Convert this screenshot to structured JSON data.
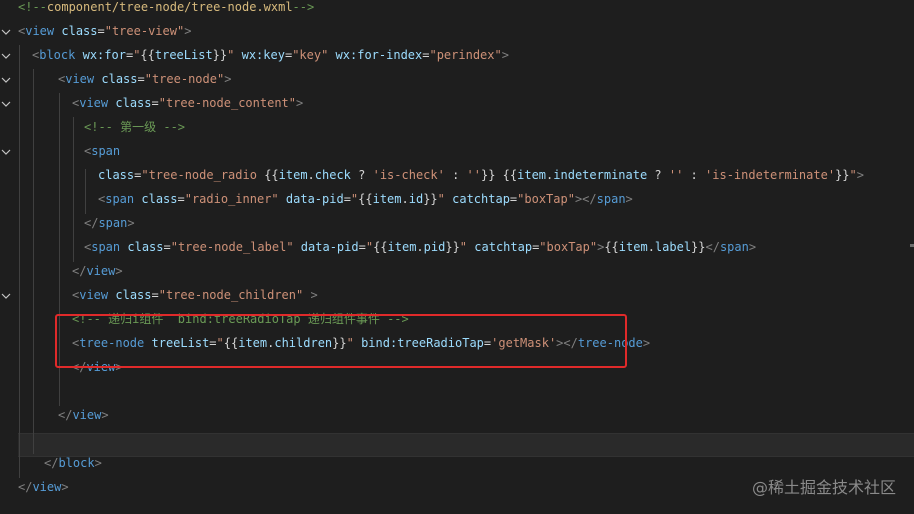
{
  "editor": {
    "colors": {
      "background": "#1e1e1e",
      "current_line": "#2a2a2a",
      "highlight_box": "#e02a2a",
      "comment": "#6a9955",
      "tag": "#569cd6",
      "attribute": "#9cdcfe",
      "string": "#ce9178",
      "text": "#d4d4d4"
    },
    "fold_icon": "chevron-down-icon",
    "lines": [
      {
        "tokens": [
          {
            "t": "<!--",
            "c": "c-comment"
          },
          {
            "t": "component/tree-node/tree-node.wxml",
            "c": "c-path"
          },
          {
            "t": "-->",
            "c": "c-comment"
          }
        ]
      },
      {
        "tokens": [
          {
            "t": "<",
            "c": "c-bracket"
          },
          {
            "t": "view",
            "c": "c-tag"
          },
          {
            "t": " ",
            "c": "c-text"
          },
          {
            "t": "class",
            "c": "c-attr"
          },
          {
            "t": "=",
            "c": "c-text"
          },
          {
            "t": "\"tree-view\"",
            "c": "c-str"
          },
          {
            "t": ">",
            "c": "c-bracket"
          }
        ]
      },
      {
        "tokens": [
          {
            "t": "<",
            "c": "c-bracket"
          },
          {
            "t": "block",
            "c": "c-tag"
          },
          {
            "t": " ",
            "c": "c-text"
          },
          {
            "t": "wx:for",
            "c": "c-attr"
          },
          {
            "t": "=",
            "c": "c-text"
          },
          {
            "t": "\"",
            "c": "c-str"
          },
          {
            "t": "{{",
            "c": "c-text"
          },
          {
            "t": "treeList",
            "c": "c-attr"
          },
          {
            "t": "}}",
            "c": "c-text"
          },
          {
            "t": "\"",
            "c": "c-str"
          },
          {
            "t": " ",
            "c": "c-text"
          },
          {
            "t": "wx:key",
            "c": "c-attr"
          },
          {
            "t": "=",
            "c": "c-text"
          },
          {
            "t": "\"key\"",
            "c": "c-str"
          },
          {
            "t": " ",
            "c": "c-text"
          },
          {
            "t": "wx:for-index",
            "c": "c-attr"
          },
          {
            "t": "=",
            "c": "c-text"
          },
          {
            "t": "\"perindex\"",
            "c": "c-str"
          },
          {
            "t": ">",
            "c": "c-bracket"
          }
        ]
      },
      {
        "tokens": [
          {
            "t": "<",
            "c": "c-bracket"
          },
          {
            "t": "view",
            "c": "c-tag"
          },
          {
            "t": " ",
            "c": "c-text"
          },
          {
            "t": "class",
            "c": "c-attr"
          },
          {
            "t": "=",
            "c": "c-text"
          },
          {
            "t": "\"tree-node\"",
            "c": "c-str"
          },
          {
            "t": ">",
            "c": "c-bracket"
          }
        ]
      },
      {
        "tokens": [
          {
            "t": "<",
            "c": "c-bracket"
          },
          {
            "t": "view",
            "c": "c-tag"
          },
          {
            "t": " ",
            "c": "c-text"
          },
          {
            "t": "class",
            "c": "c-attr"
          },
          {
            "t": "=",
            "c": "c-text"
          },
          {
            "t": "\"tree-node_content\"",
            "c": "c-str"
          },
          {
            "t": ">",
            "c": "c-bracket"
          }
        ]
      },
      {
        "tokens": [
          {
            "t": "<!-- 第一级 -->",
            "c": "c-comment"
          }
        ]
      },
      {
        "tokens": [
          {
            "t": "<",
            "c": "c-bracket"
          },
          {
            "t": "span",
            "c": "c-tag"
          }
        ]
      },
      {
        "tokens": [
          {
            "t": "class",
            "c": "c-attr"
          },
          {
            "t": "=",
            "c": "c-text"
          },
          {
            "t": "\"tree-node_radio ",
            "c": "c-str"
          },
          {
            "t": "{{",
            "c": "c-text"
          },
          {
            "t": "item",
            "c": "c-attr"
          },
          {
            "t": ".",
            "c": "c-text"
          },
          {
            "t": "check",
            "c": "c-attr"
          },
          {
            "t": " ? ",
            "c": "c-text"
          },
          {
            "t": "'is-check'",
            "c": "c-str"
          },
          {
            "t": " : ",
            "c": "c-text"
          },
          {
            "t": "''",
            "c": "c-str"
          },
          {
            "t": "}}",
            "c": "c-text"
          },
          {
            "t": " ",
            "c": "c-str"
          },
          {
            "t": "{{",
            "c": "c-text"
          },
          {
            "t": "item",
            "c": "c-attr"
          },
          {
            "t": ".",
            "c": "c-text"
          },
          {
            "t": "indeterminate",
            "c": "c-attr"
          },
          {
            "t": " ? ",
            "c": "c-text"
          },
          {
            "t": "''",
            "c": "c-str"
          },
          {
            "t": " : ",
            "c": "c-text"
          },
          {
            "t": "'is-indeterminate'",
            "c": "c-str"
          },
          {
            "t": "}}",
            "c": "c-text"
          },
          {
            "t": "\"",
            "c": "c-str"
          },
          {
            "t": ">",
            "c": "c-bracket"
          }
        ]
      },
      {
        "tokens": [
          {
            "t": "<",
            "c": "c-bracket"
          },
          {
            "t": "span",
            "c": "c-tag"
          },
          {
            "t": " ",
            "c": "c-text"
          },
          {
            "t": "class",
            "c": "c-attr"
          },
          {
            "t": "=",
            "c": "c-text"
          },
          {
            "t": "\"radio_inner\"",
            "c": "c-str"
          },
          {
            "t": " ",
            "c": "c-text"
          },
          {
            "t": "data-pid",
            "c": "c-attr"
          },
          {
            "t": "=",
            "c": "c-text"
          },
          {
            "t": "\"",
            "c": "c-str"
          },
          {
            "t": "{{",
            "c": "c-text"
          },
          {
            "t": "item",
            "c": "c-attr"
          },
          {
            "t": ".",
            "c": "c-text"
          },
          {
            "t": "id",
            "c": "c-attr"
          },
          {
            "t": "}}",
            "c": "c-text"
          },
          {
            "t": "\"",
            "c": "c-str"
          },
          {
            "t": " ",
            "c": "c-text"
          },
          {
            "t": "catchtap",
            "c": "c-attr"
          },
          {
            "t": "=",
            "c": "c-text"
          },
          {
            "t": "\"boxTap\"",
            "c": "c-str"
          },
          {
            "t": "></",
            "c": "c-bracket"
          },
          {
            "t": "span",
            "c": "c-tag"
          },
          {
            "t": ">",
            "c": "c-bracket"
          }
        ]
      },
      {
        "tokens": [
          {
            "t": "</",
            "c": "c-bracket"
          },
          {
            "t": "span",
            "c": "c-tag"
          },
          {
            "t": ">",
            "c": "c-bracket"
          }
        ]
      },
      {
        "tokens": [
          {
            "t": "<",
            "c": "c-bracket"
          },
          {
            "t": "span",
            "c": "c-tag"
          },
          {
            "t": " ",
            "c": "c-text"
          },
          {
            "t": "class",
            "c": "c-attr"
          },
          {
            "t": "=",
            "c": "c-text"
          },
          {
            "t": "\"tree-node_label\"",
            "c": "c-str"
          },
          {
            "t": " ",
            "c": "c-text"
          },
          {
            "t": "data-pid",
            "c": "c-attr"
          },
          {
            "t": "=",
            "c": "c-text"
          },
          {
            "t": "\"",
            "c": "c-str"
          },
          {
            "t": "{{",
            "c": "c-text"
          },
          {
            "t": "item",
            "c": "c-attr"
          },
          {
            "t": ".",
            "c": "c-text"
          },
          {
            "t": "pid",
            "c": "c-attr"
          },
          {
            "t": "}}",
            "c": "c-text"
          },
          {
            "t": "\"",
            "c": "c-str"
          },
          {
            "t": " ",
            "c": "c-text"
          },
          {
            "t": "catchtap",
            "c": "c-attr"
          },
          {
            "t": "=",
            "c": "c-text"
          },
          {
            "t": "\"boxTap\"",
            "c": "c-str"
          },
          {
            "t": ">",
            "c": "c-bracket"
          },
          {
            "t": "{{",
            "c": "c-text"
          },
          {
            "t": "item",
            "c": "c-attr"
          },
          {
            "t": ".",
            "c": "c-text"
          },
          {
            "t": "label",
            "c": "c-attr"
          },
          {
            "t": "}}",
            "c": "c-text"
          },
          {
            "t": "</",
            "c": "c-bracket"
          },
          {
            "t": "span",
            "c": "c-tag"
          },
          {
            "t": ">",
            "c": "c-bracket"
          }
        ]
      },
      {
        "tokens": [
          {
            "t": "</",
            "c": "c-bracket"
          },
          {
            "t": "view",
            "c": "c-tag"
          },
          {
            "t": ">",
            "c": "c-bracket"
          }
        ]
      },
      {
        "tokens": [
          {
            "t": "<",
            "c": "c-bracket"
          },
          {
            "t": "view",
            "c": "c-tag"
          },
          {
            "t": " ",
            "c": "c-text"
          },
          {
            "t": "class",
            "c": "c-attr"
          },
          {
            "t": "=",
            "c": "c-text"
          },
          {
            "t": "\"tree-node_children\"",
            "c": "c-str"
          },
          {
            "t": " >",
            "c": "c-bracket"
          }
        ]
      },
      {
        "tokens": [
          {
            "t": "<!-- 递归i组件  bind:treeRadioTap 递归组件事件 -->",
            "c": "c-comment"
          }
        ]
      },
      {
        "tokens": [
          {
            "t": "<",
            "c": "c-bracket"
          },
          {
            "t": "tree-node",
            "c": "c-tag"
          },
          {
            "t": " ",
            "c": "c-text"
          },
          {
            "t": "treeList",
            "c": "c-attr"
          },
          {
            "t": "=",
            "c": "c-text"
          },
          {
            "t": "\"",
            "c": "c-str"
          },
          {
            "t": "{{",
            "c": "c-text"
          },
          {
            "t": "item",
            "c": "c-attr"
          },
          {
            "t": ".",
            "c": "c-text"
          },
          {
            "t": "children",
            "c": "c-attr"
          },
          {
            "t": "}}",
            "c": "c-text"
          },
          {
            "t": "\"",
            "c": "c-str"
          },
          {
            "t": " ",
            "c": "c-text"
          },
          {
            "t": "bind:treeRadioTap",
            "c": "c-attr"
          },
          {
            "t": "=",
            "c": "c-text"
          },
          {
            "t": "'getMask'",
            "c": "c-str"
          },
          {
            "t": "></",
            "c": "c-bracket"
          },
          {
            "t": "tree-node",
            "c": "c-tag"
          },
          {
            "t": ">",
            "c": "c-bracket"
          }
        ]
      },
      {
        "tokens": [
          {
            "t": "</",
            "c": "c-bracket"
          },
          {
            "t": "view",
            "c": "c-tag"
          },
          {
            "t": ">",
            "c": "c-bracket"
          }
        ]
      },
      {
        "tokens": []
      },
      {
        "tokens": [
          {
            "t": "</",
            "c": "c-bracket"
          },
          {
            "t": "view",
            "c": "c-tag"
          },
          {
            "t": ">",
            "c": "c-bracket"
          }
        ]
      },
      {
        "tokens": []
      },
      {
        "tokens": [
          {
            "t": "</",
            "c": "c-bracket"
          },
          {
            "t": "block",
            "c": "c-tag"
          },
          {
            "t": ">",
            "c": "c-bracket"
          }
        ]
      },
      {
        "tokens": [
          {
            "t": "</",
            "c": "c-bracket"
          },
          {
            "t": "view",
            "c": "c-tag"
          },
          {
            "t": ">",
            "c": "c-bracket"
          }
        ]
      }
    ]
  },
  "watermark": {
    "text": "@稀土掘金技术社区"
  }
}
